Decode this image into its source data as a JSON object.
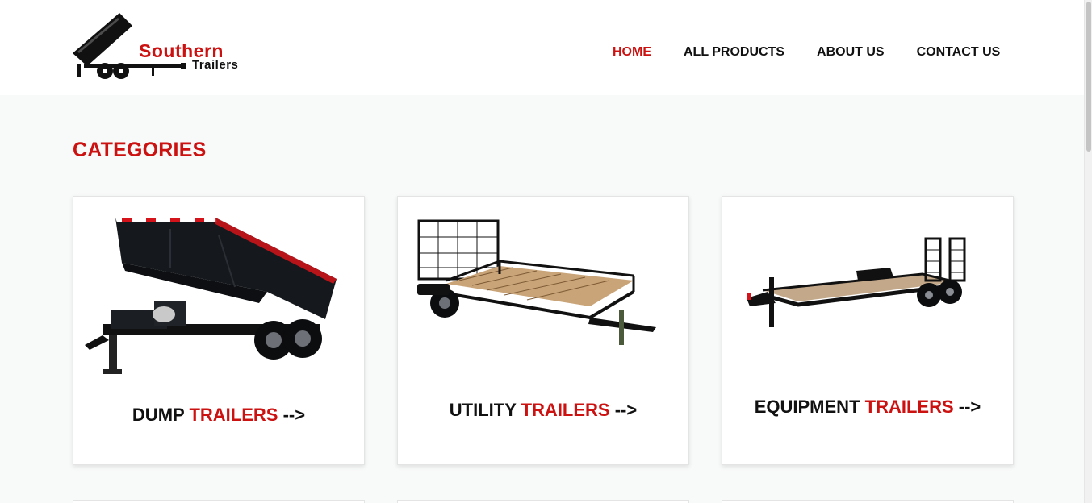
{
  "brand": {
    "name_line1": "Southern",
    "name_line2": "Trailers"
  },
  "nav": {
    "items": [
      {
        "label": "HOME",
        "active": true
      },
      {
        "label": "ALL PRODUCTS",
        "active": false
      },
      {
        "label": "ABOUT US",
        "active": false
      },
      {
        "label": "CONTACT US",
        "active": false
      }
    ]
  },
  "main": {
    "title": "CATEGORIES",
    "categories": [
      {
        "word": "DUMP",
        "accent": "TRAILERS",
        "arrow": "-->",
        "image": "dump-trailer"
      },
      {
        "word": "UTILITY",
        "accent": "TRAILERS",
        "arrow": "-->",
        "image": "utility-trailer"
      },
      {
        "word": "EQUIPMENT",
        "accent": "TRAILERS",
        "arrow": "-->",
        "image": "equipment-trailer"
      }
    ]
  },
  "colors": {
    "accent": "#cc1111",
    "text": "#111111",
    "page_bg": "#f8f9f9"
  }
}
